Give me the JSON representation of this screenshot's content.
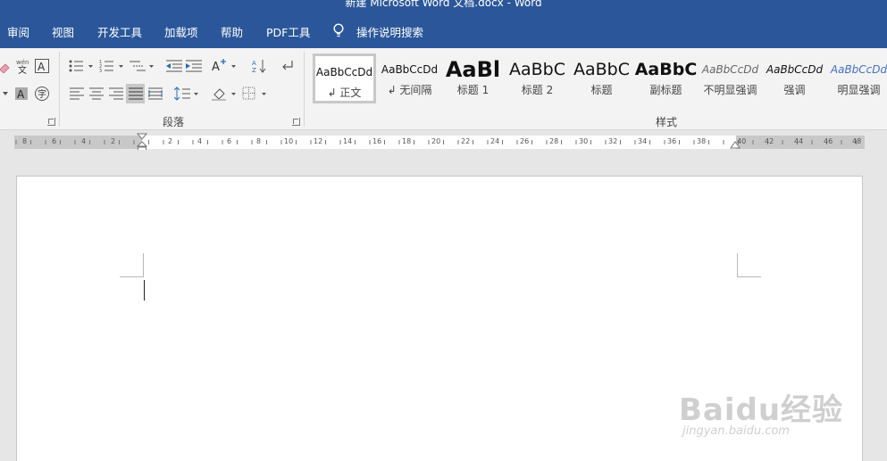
{
  "window": {
    "title": "新建 Microsoft Word 文档.docx  -  Word"
  },
  "tabs": [
    {
      "label": "审阅"
    },
    {
      "label": "视图"
    },
    {
      "label": "开发工具"
    },
    {
      "label": "加载项"
    },
    {
      "label": "帮助"
    },
    {
      "label": "PDF工具"
    }
  ],
  "tell_me": {
    "label": "操作说明搜索",
    "icon": "lightbulb-icon"
  },
  "groups": {
    "paragraph": {
      "label": "段落"
    },
    "styles": {
      "label": "样式"
    }
  },
  "styles_gallery": [
    {
      "preview": "AaBbCcDd",
      "name": "↲ 正文",
      "selected": true
    },
    {
      "preview": "AaBbCcDd",
      "name": "↲ 无间隔",
      "selected": false
    },
    {
      "preview": "AaBl",
      "name": "标题 1",
      "selected": false
    },
    {
      "preview": "AaBbC",
      "name": "标题 2",
      "selected": false
    },
    {
      "preview": "AaBbC",
      "name": "标题",
      "selected": false
    },
    {
      "preview": "AaBbC",
      "name": "副标题",
      "selected": false
    },
    {
      "preview": "AaBbCcDd",
      "name": "不明显强调",
      "selected": false
    },
    {
      "preview": "AaBbCcDd",
      "name": "强调",
      "selected": false
    },
    {
      "preview": "AaBbCcDd",
      "name": "明显强调",
      "selected": false
    }
  ],
  "ruler": {
    "left_labels": [
      "8",
      "6",
      "4",
      "2"
    ],
    "labels": [
      "2",
      "4",
      "6",
      "8",
      "10",
      "12",
      "14",
      "16",
      "18",
      "20",
      "22",
      "24",
      "26",
      "28",
      "30",
      "32",
      "34",
      "36",
      "38",
      "40"
    ],
    "right_labels": [
      "42",
      "44",
      "46",
      "48"
    ]
  },
  "watermark": {
    "logo": "Baidu经验",
    "url": "jingyan.baidu.com"
  },
  "colors": {
    "ribbon_blue": "#2b579a",
    "ribbon_bg": "#f3f3f3",
    "page": "#ffffff",
    "workspace": "#e6e6e6"
  }
}
